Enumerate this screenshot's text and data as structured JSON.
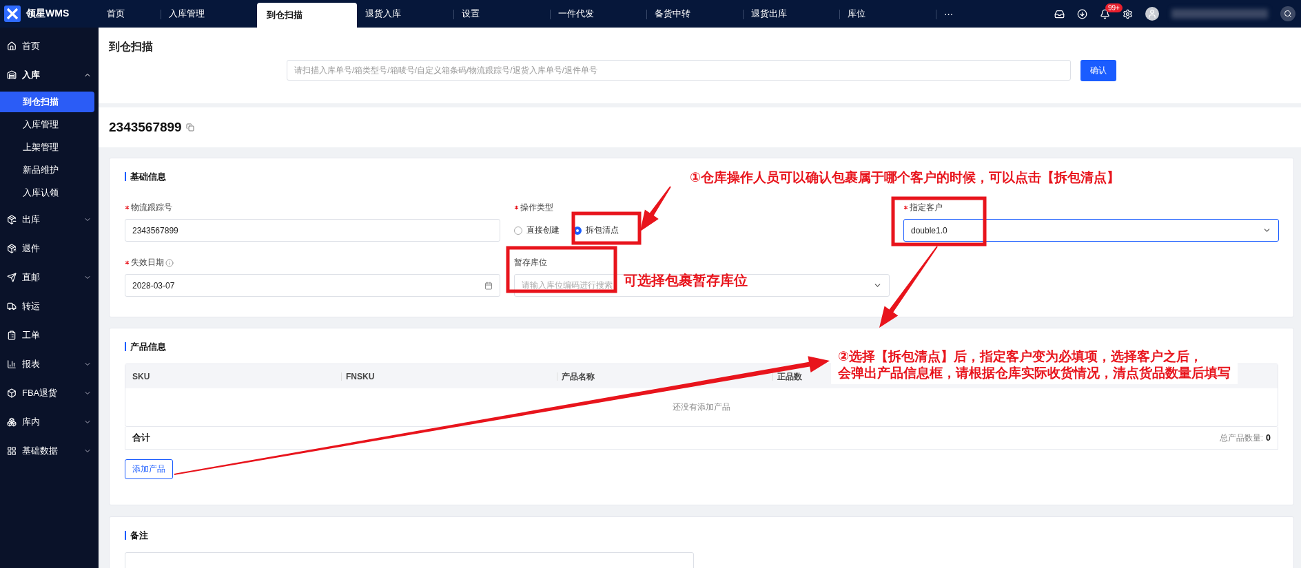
{
  "app": {
    "logo_text": "领星WMS"
  },
  "top_nav": [
    {
      "label": "首页",
      "selected": false
    },
    {
      "label": "入库管理",
      "selected": false
    },
    {
      "label": "到仓扫描",
      "selected": true
    },
    {
      "label": "退货入库",
      "selected": false
    },
    {
      "label": "设置",
      "selected": false
    },
    {
      "label": "一件代发",
      "selected": false
    },
    {
      "label": "备货中转",
      "selected": false
    },
    {
      "label": "退货出库",
      "selected": false
    },
    {
      "label": "库位",
      "selected": false
    },
    {
      "label": "⋯",
      "selected": false
    }
  ],
  "header_tools": {
    "badge": "99+"
  },
  "sidebar": [
    {
      "label": "首页"
    },
    {
      "label": "入库",
      "expanded": true,
      "children": [
        {
          "label": "到仓扫描",
          "selected": true
        },
        {
          "label": "入库管理",
          "selected": false
        },
        {
          "label": "上架管理",
          "selected": false
        },
        {
          "label": "新品维护",
          "selected": false
        },
        {
          "label": "入库认领",
          "selected": false
        }
      ]
    },
    {
      "label": "出库",
      "expanded": false
    },
    {
      "label": "退件"
    },
    {
      "label": "直邮",
      "expanded": false
    },
    {
      "label": "转运"
    },
    {
      "label": "工单"
    },
    {
      "label": "报表",
      "expanded": false
    },
    {
      "label": "FBA退货",
      "expanded": false
    },
    {
      "label": "库内",
      "expanded": false
    },
    {
      "label": "基础数据",
      "expanded": false
    }
  ],
  "page": {
    "title": "到仓扫描",
    "scan": {
      "placeholder": "请扫描入库单号/箱类型号/箱唛号/自定义箱条码/物流跟踪号/退货入库单号/退件单号",
      "button": "确认"
    },
    "number": "2343567899"
  },
  "basic_info": {
    "title": "基础信息",
    "fields": [
      {
        "kind": "text",
        "label": "物流跟踪号",
        "required": true,
        "value": "2343567899",
        "focused": false
      },
      {
        "kind": "radio",
        "label": "操作类型",
        "required": true,
        "options": [
          {
            "label": "直接创建",
            "selected": false
          },
          {
            "label": "拆包清点",
            "selected": true
          }
        ]
      },
      {
        "kind": "select",
        "label": "指定客户",
        "required": true,
        "value": "double1.0",
        "focused": true
      },
      {
        "kind": "date",
        "label": "失效日期",
        "required": true,
        "info": true,
        "value": "2028-03-07",
        "focused": false
      },
      {
        "kind": "select",
        "label": "暂存库位",
        "required": false,
        "placeholder": "请输入库位编码进行搜索",
        "focused": false
      }
    ]
  },
  "products": {
    "title": "产品信息",
    "columns": [
      "SKU",
      "FNSKU",
      "产品名称",
      "正品数"
    ],
    "empty_text": "还没有添加产品",
    "total_label": "合计",
    "total_count_label": "总产品数量:",
    "total_count": "0",
    "add_button": "添加产品"
  },
  "remarks": {
    "title": "备注"
  },
  "annotations": [
    {
      "lines": [
        "①仓库操作人员可以确认包裹属于哪个客户的时候，可以点击【拆包清点】"
      ]
    },
    {
      "lines": [
        "可选择包裹暂存库位"
      ]
    },
    {
      "lines": [
        "②选择【拆包清点】后，指定客户变为必填项，选择客户之后，",
        "会弹出产品信息框，请根据仓库实际收货情况，清点货品数量后填写"
      ]
    }
  ]
}
